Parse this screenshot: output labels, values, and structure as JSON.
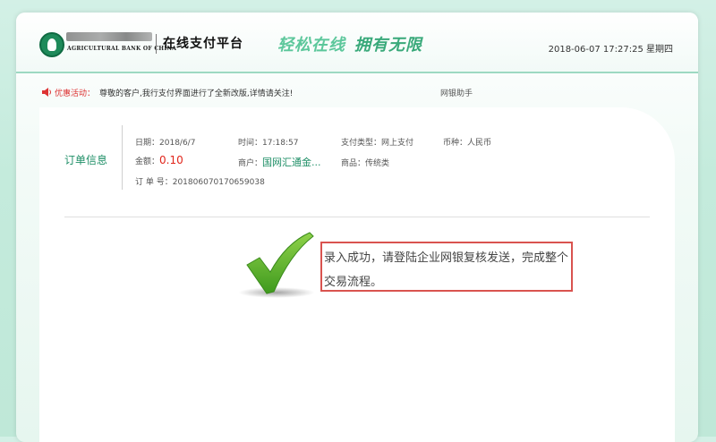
{
  "header": {
    "bank_name_en": "AGRICULTURAL BANK OF CHINA",
    "platform_name": "在线支付平台",
    "slogan_part1": "轻松在线",
    "slogan_part2": "拥有无限",
    "datetime": "2018-06-07 17:27:25 星期四"
  },
  "notice": {
    "label": "优惠活动：",
    "text": "尊敬的客户,我行支付界面进行了全新改版,详情请关注!",
    "help_link": "网银助手"
  },
  "order": {
    "title": "订单信息",
    "date_label": "日期：",
    "date_value": "2018/6/7",
    "time_label": "时间：",
    "time_value": "17:18:57",
    "paytype_label": "支付类型：",
    "paytype_value": "网上支付",
    "currency_label": "币种：",
    "currency_value": "人民币",
    "amount_label": "金额：",
    "amount_value": "0.10",
    "merchant_label": "商户：",
    "merchant_value": "国网汇通金...",
    "product_label": "商品：",
    "product_value": "传统类",
    "orderno_label": "订 单 号：",
    "orderno_value": "201806070170659038"
  },
  "result": {
    "message": "录入成功，请登陆企业网银复核发送，完成整个交易流程。"
  },
  "icons": {
    "logo": "abc-logo-icon",
    "speaker": "speaker-icon",
    "success": "checkmark-icon"
  },
  "colors": {
    "brand_green": "#1f8f67",
    "amount_red": "#e1251b",
    "highlight_border": "#d9534f",
    "check_green": "#5fb32a"
  }
}
